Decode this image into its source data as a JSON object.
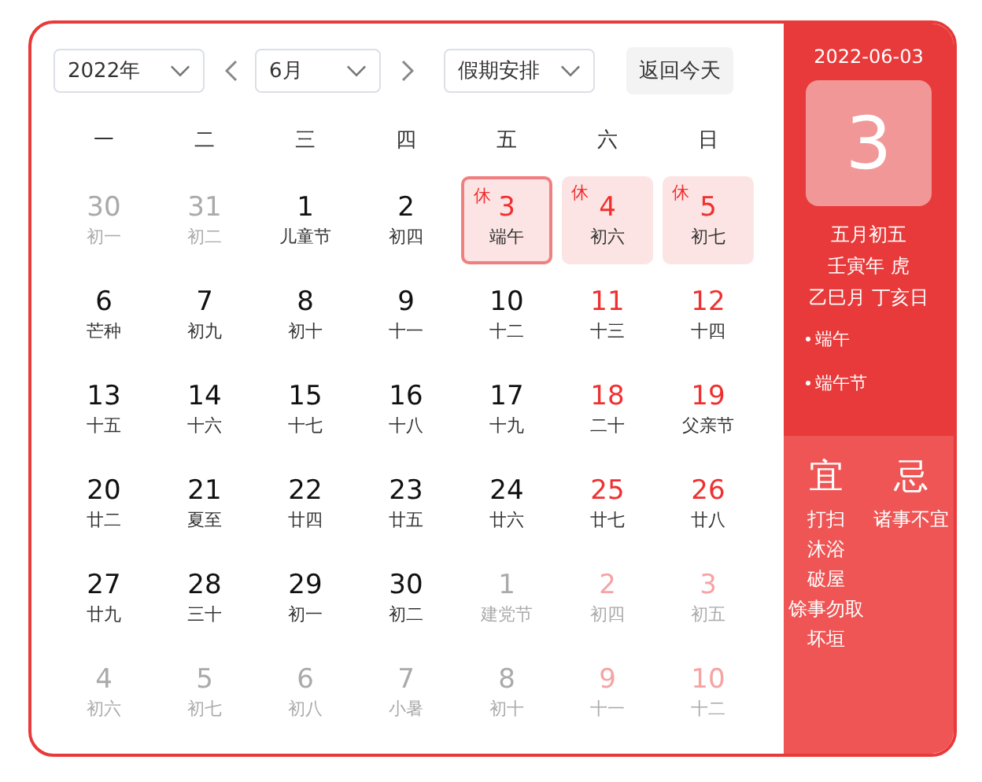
{
  "toolbar": {
    "year": "2022年",
    "month": "6月",
    "holiday": "假期安排",
    "today_button": "返回今天"
  },
  "weekdays": [
    "一",
    "二",
    "三",
    "四",
    "五",
    "六",
    "日"
  ],
  "days": [
    {
      "day": "30",
      "lunar": "初一",
      "other_month": true,
      "weekend": false,
      "selected": false
    },
    {
      "day": "31",
      "lunar": "初二",
      "other_month": true,
      "weekend": false,
      "selected": false
    },
    {
      "day": "1",
      "lunar": "儿童节",
      "other_month": false,
      "weekend": false,
      "selected": false
    },
    {
      "day": "2",
      "lunar": "初四",
      "other_month": false,
      "weekend": false,
      "selected": false
    },
    {
      "day": "3",
      "lunar": "端午",
      "other_month": false,
      "weekend": true,
      "badge": "休",
      "selected": true
    },
    {
      "day": "4",
      "lunar": "初六",
      "other_month": false,
      "weekend": true,
      "badge": "休",
      "selected": false
    },
    {
      "day": "5",
      "lunar": "初七",
      "other_month": false,
      "weekend": true,
      "badge": "休",
      "selected": false
    },
    {
      "day": "6",
      "lunar": "芒种",
      "other_month": false,
      "weekend": false,
      "selected": false
    },
    {
      "day": "7",
      "lunar": "初九",
      "other_month": false,
      "weekend": false,
      "selected": false
    },
    {
      "day": "8",
      "lunar": "初十",
      "other_month": false,
      "weekend": false,
      "selected": false
    },
    {
      "day": "9",
      "lunar": "十一",
      "other_month": false,
      "weekend": false,
      "selected": false
    },
    {
      "day": "10",
      "lunar": "十二",
      "other_month": false,
      "weekend": false,
      "selected": false
    },
    {
      "day": "11",
      "lunar": "十三",
      "other_month": false,
      "weekend": true,
      "selected": false
    },
    {
      "day": "12",
      "lunar": "十四",
      "other_month": false,
      "weekend": true,
      "selected": false
    },
    {
      "day": "13",
      "lunar": "十五",
      "other_month": false,
      "weekend": false,
      "selected": false
    },
    {
      "day": "14",
      "lunar": "十六",
      "other_month": false,
      "weekend": false,
      "selected": false
    },
    {
      "day": "15",
      "lunar": "十七",
      "other_month": false,
      "weekend": false,
      "selected": false
    },
    {
      "day": "16",
      "lunar": "十八",
      "other_month": false,
      "weekend": false,
      "selected": false
    },
    {
      "day": "17",
      "lunar": "十九",
      "other_month": false,
      "weekend": false,
      "selected": false
    },
    {
      "day": "18",
      "lunar": "二十",
      "other_month": false,
      "weekend": true,
      "selected": false
    },
    {
      "day": "19",
      "lunar": "父亲节",
      "other_month": false,
      "weekend": true,
      "selected": false
    },
    {
      "day": "20",
      "lunar": "廿二",
      "other_month": false,
      "weekend": false,
      "selected": false
    },
    {
      "day": "21",
      "lunar": "夏至",
      "other_month": false,
      "weekend": false,
      "selected": false
    },
    {
      "day": "22",
      "lunar": "廿四",
      "other_month": false,
      "weekend": false,
      "selected": false
    },
    {
      "day": "23",
      "lunar": "廿五",
      "other_month": false,
      "weekend": false,
      "selected": false
    },
    {
      "day": "24",
      "lunar": "廿六",
      "other_month": false,
      "weekend": false,
      "selected": false
    },
    {
      "day": "25",
      "lunar": "廿七",
      "other_month": false,
      "weekend": true,
      "selected": false
    },
    {
      "day": "26",
      "lunar": "廿八",
      "other_month": false,
      "weekend": true,
      "selected": false
    },
    {
      "day": "27",
      "lunar": "廿九",
      "other_month": false,
      "weekend": false,
      "selected": false
    },
    {
      "day": "28",
      "lunar": "三十",
      "other_month": false,
      "weekend": false,
      "selected": false
    },
    {
      "day": "29",
      "lunar": "初一",
      "other_month": false,
      "weekend": false,
      "selected": false
    },
    {
      "day": "30",
      "lunar": "初二",
      "other_month": false,
      "weekend": false,
      "selected": false
    },
    {
      "day": "1",
      "lunar": "建党节",
      "other_month": true,
      "weekend": false,
      "selected": false
    },
    {
      "day": "2",
      "lunar": "初四",
      "other_month": true,
      "weekend": true,
      "selected": false
    },
    {
      "day": "3",
      "lunar": "初五",
      "other_month": true,
      "weekend": true,
      "selected": false
    },
    {
      "day": "4",
      "lunar": "初六",
      "other_month": true,
      "weekend": false,
      "selected": false
    },
    {
      "day": "5",
      "lunar": "初七",
      "other_month": true,
      "weekend": false,
      "selected": false
    },
    {
      "day": "6",
      "lunar": "初八",
      "other_month": true,
      "weekend": false,
      "selected": false
    },
    {
      "day": "7",
      "lunar": "小暑",
      "other_month": true,
      "weekend": false,
      "selected": false
    },
    {
      "day": "8",
      "lunar": "初十",
      "other_month": true,
      "weekend": false,
      "selected": false
    },
    {
      "day": "9",
      "lunar": "十一",
      "other_month": true,
      "weekend": true,
      "selected": false
    },
    {
      "day": "10",
      "lunar": "十二",
      "other_month": true,
      "weekend": true,
      "selected": false
    }
  ],
  "detail": {
    "date": "2022-06-03",
    "day": "3",
    "lunar_date": "五月初五",
    "year_info": "壬寅年 虎",
    "month_day_info": "乙巳月 丁亥日",
    "festivals": [
      "端午",
      "端午节"
    ],
    "suitable": {
      "heading": "宜",
      "items": [
        "打扫",
        "沐浴",
        "破屋",
        "馀事勿取",
        "坏垣"
      ]
    },
    "avoid": {
      "heading": "忌",
      "items": [
        "诸事不宜"
      ]
    }
  }
}
